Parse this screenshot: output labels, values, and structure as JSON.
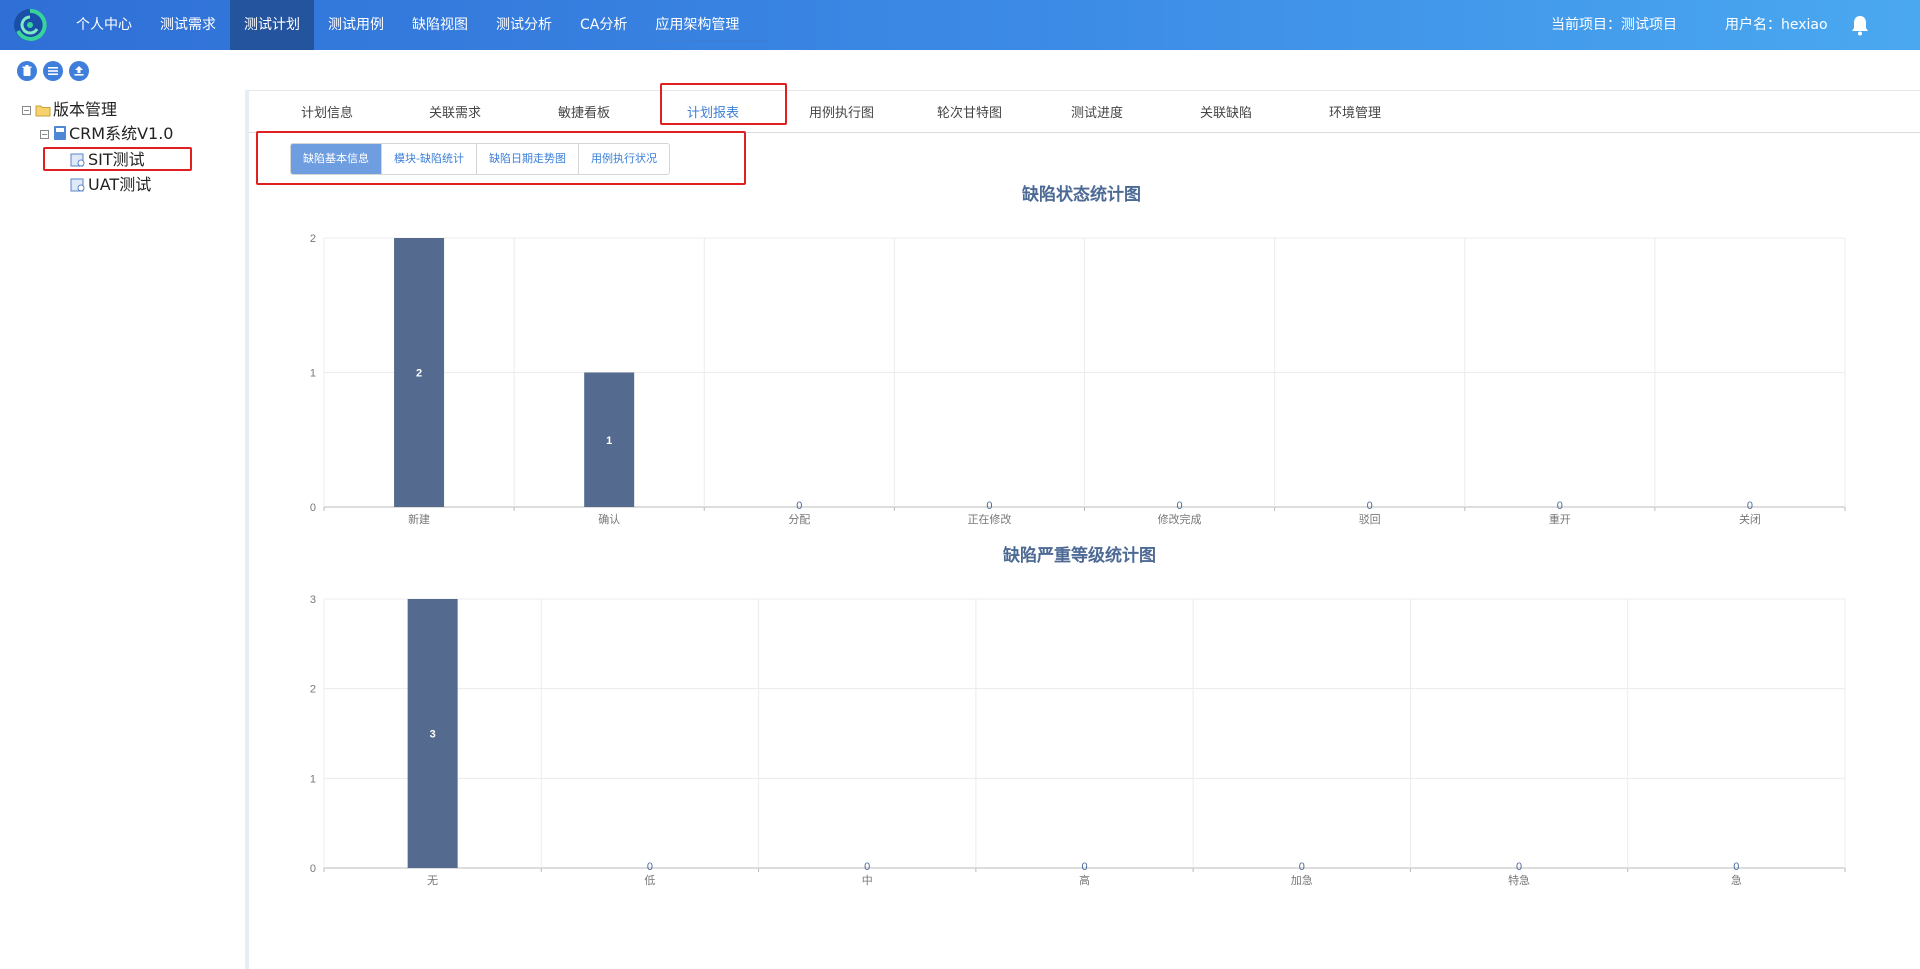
{
  "nav": {
    "items": [
      "个人中心",
      "测试需求",
      "测试计划",
      "测试用例",
      "缺陷视图",
      "测试分析",
      "CA分析",
      "应用架构管理"
    ],
    "active_index": 2,
    "current_project": "当前项目：测试项目",
    "username": "用户名：hexiao"
  },
  "toolbar": {
    "icons": [
      "trash-icon",
      "list-icon",
      "upload-icon"
    ]
  },
  "tree": {
    "root": "版本管理",
    "version": "CRM系统V1.0",
    "children": [
      "SIT测试",
      "UAT测试"
    ],
    "selected": "SIT测试"
  },
  "tabs": {
    "items": [
      "计划信息",
      "关联需求",
      "敏捷看板",
      "计划报表",
      "用例执行图",
      "轮次甘特图",
      "测试进度",
      "关联缺陷",
      "环境管理"
    ],
    "active_index": 3
  },
  "subtabs": {
    "items": [
      "缺陷基本信息",
      "模块-缺陷统计",
      "缺陷日期走势图",
      "用例执行状况"
    ],
    "active_index": 0
  },
  "chart_data": [
    {
      "type": "bar",
      "title": "缺陷状态统计图",
      "categories": [
        "新建",
        "确认",
        "分配",
        "正在修改",
        "修改完成",
        "驳回",
        "重开",
        "关闭"
      ],
      "values": [
        2,
        1,
        0,
        0,
        0,
        0,
        0,
        0
      ],
      "yticks": [
        "0",
        "1",
        "2"
      ],
      "ylim": [
        0,
        2
      ],
      "bar_color": "#546b8f",
      "grid": true
    },
    {
      "type": "bar",
      "title": "缺陷严重等级统计图",
      "categories": [
        "无",
        "低",
        "中",
        "高",
        "加急",
        "特急",
        "急"
      ],
      "values": [
        3,
        0,
        0,
        0,
        0,
        0,
        0
      ],
      "yticks": [
        "0",
        "1",
        "2",
        "3"
      ],
      "ylim": [
        0,
        3
      ],
      "bar_color": "#546b8f",
      "grid": true
    }
  ]
}
